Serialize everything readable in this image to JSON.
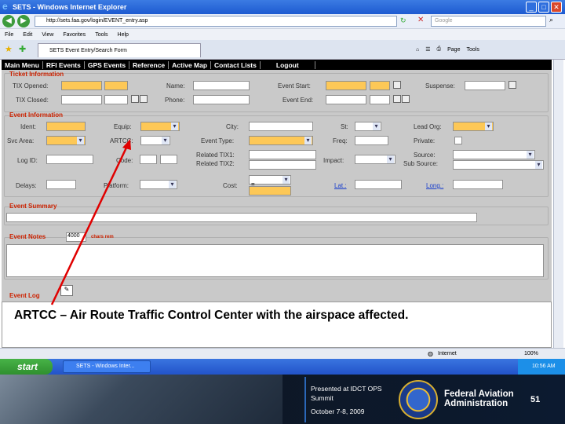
{
  "window": {
    "title": "SETS - Windows Internet Explorer"
  },
  "address": {
    "url": "http://sets.faa.gov/login/EVENT_entry.asp",
    "search_placeholder": "Google"
  },
  "menu": [
    "File",
    "Edit",
    "View",
    "Favorites",
    "Tools",
    "Help"
  ],
  "tab": {
    "label": "SETS Event Entry/Search Form"
  },
  "toolbar": {
    "page": "Page",
    "tools": "Tools"
  },
  "app_nav": [
    "Main Menu",
    "RFI Events",
    "GPS Events",
    "Reference",
    "Active Map",
    "Contact Lists",
    "Logout"
  ],
  "ticket": {
    "header": "Ticket Information",
    "tix_opened": "TIX Opened:",
    "name": "Name:",
    "event_start": "Event Start:",
    "suspense": "Suspense:",
    "tix_closed": "TIX Closed:",
    "phone": "Phone:",
    "event_end": "Event End:"
  },
  "event_info": {
    "header": "Event Information",
    "ident": "Ident:",
    "equip": "Equip:",
    "city": "City:",
    "st": "St:",
    "lead_org": "Lead Org:",
    "svc_area": "Svc Area:",
    "artcc": "ARTCC:",
    "event_type": "Event Type:",
    "freq": "Freq:",
    "private": "Private:",
    "log_id": "Log ID:",
    "code": "Code:",
    "related_tix1": "Related TIX1:",
    "related_tix2": "Related TIX2:",
    "impact": "Impact:",
    "source": "Source:",
    "sub_source": "Sub Source:",
    "delays": "Delays:",
    "platform": "Platform:",
    "cost": "Cost:",
    "cost_currency": "=",
    "lat": "Lat.:",
    "long": "Long.:"
  },
  "summary": {
    "header": "Event Summary"
  },
  "notes": {
    "header": "Event Notes",
    "chars_value": "4000",
    "chars_label": "chars rem"
  },
  "log": {
    "header": "Event Log"
  },
  "caption": "ARTCC – Air Route Traffic Control Center with the airspace affected.",
  "status": {
    "zone": "Internet",
    "zoom": "100%"
  },
  "taskbar": {
    "start": "start",
    "task": "SETS - Windows Inter...",
    "clock": "10:56 AM"
  },
  "footer": {
    "line1": "Presented at IDCT OPS Summit",
    "line2": "October 7-8, 2009",
    "org": "Federal Aviation Administration",
    "page": "51"
  },
  "colors": {
    "required_field": "#fdc857",
    "section_header": "#cc2200",
    "caption_arrow": "#e00000"
  }
}
